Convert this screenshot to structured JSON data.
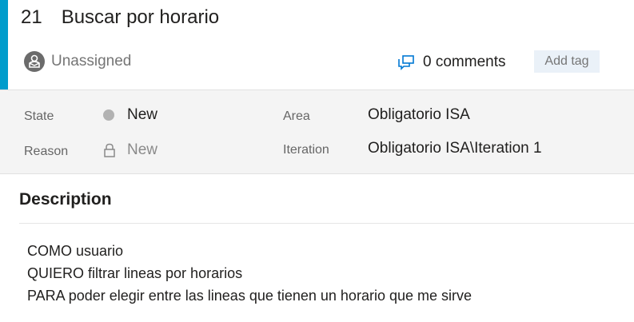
{
  "work_item": {
    "id": "21",
    "title": "Buscar por horario",
    "assigned_to": "Unassigned",
    "comments_label": "0 comments",
    "add_tag_label": "Add tag"
  },
  "fields": {
    "state": {
      "label": "State",
      "value": "New"
    },
    "reason": {
      "label": "Reason",
      "value": "New"
    },
    "area": {
      "label": "Area",
      "value": "Obligatorio ISA"
    },
    "iteration": {
      "label": "Iteration",
      "value": "Obligatorio ISA\\Iteration 1"
    }
  },
  "description": {
    "heading": "Description",
    "lines": [
      "COMO usuario",
      "QUIERO filtrar lineas por horarios",
      "PARA poder elegir entre las lineas que tienen un horario que me sirve"
    ]
  },
  "colors": {
    "accent": "#009ccc",
    "state_new": "#b2b2b2",
    "tag_bg": "#eaf1f8",
    "comment_icon": "#0078d4"
  },
  "icons": {
    "assignee": "person-icon",
    "comments": "comments-icon",
    "reason_locked": "lock-icon",
    "state_dot": "state-dot-icon"
  }
}
